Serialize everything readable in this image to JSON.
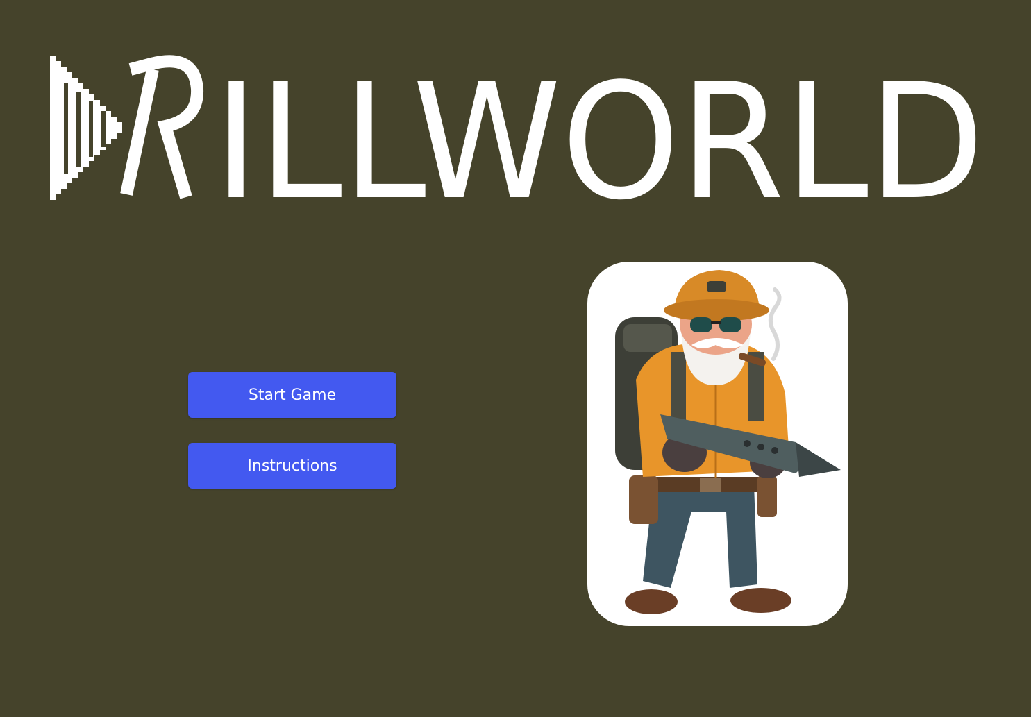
{
  "logo": {
    "title": "DRILLWORLD",
    "icon": "drill-bit-logo-icon",
    "color": "#ffffff"
  },
  "menu": {
    "start_label": "Start Game",
    "instructions_label": "Instructions",
    "button_color": "#4359f0"
  },
  "character": {
    "icon": "miner-character-portrait",
    "card_color": "#ffffff"
  },
  "colors": {
    "background": "#45432b"
  }
}
